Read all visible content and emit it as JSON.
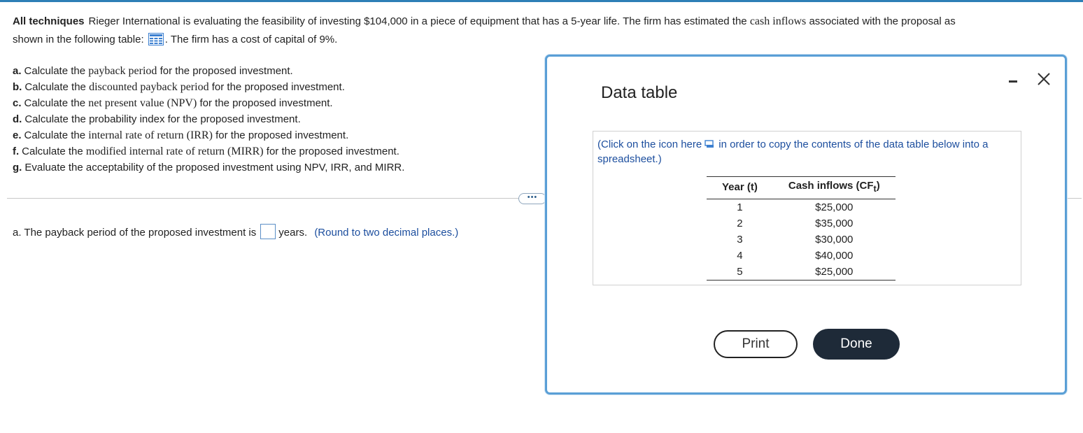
{
  "intro": {
    "label": "All techniques",
    "text_part1": "Rieger International is evaluating the feasibility of investing $104,000 in a piece of equipment that has a 5-year life. The firm has estimated the",
    "cash_inflows": "cash inflows",
    "text_part2": "associated with the proposal as",
    "line2_prefix": "shown in the following table:",
    "line2_suffix": ". The firm has a cost of capital of 9%.",
    "table_icon": "data-table-grid-icon"
  },
  "parts": [
    {
      "letter": "a.",
      "pre": "Calculate the",
      "term": "payback period",
      "post": "for the proposed investment."
    },
    {
      "letter": "b.",
      "pre": "Calculate the",
      "term": "discounted payback period",
      "post": "for the proposed investment."
    },
    {
      "letter": "c.",
      "pre": "Calculate the",
      "term": "net present value (NPV)",
      "post": "for the proposed investment."
    },
    {
      "letter": "d.",
      "pre": "Calculate the probability index for the proposed investment.",
      "term": "",
      "post": ""
    },
    {
      "letter": "e.",
      "pre": "Calculate the",
      "term": "internal rate of return (IRR)",
      "post": "for the proposed investment."
    },
    {
      "letter": "f.",
      "pre": "Calculate the",
      "term": "modified internal rate of return (MIRR)",
      "post": "for the proposed investment."
    },
    {
      "letter": "g.",
      "pre": "Evaluate the acceptability of the proposed investment using NPV, IRR, and MIRR.",
      "term": "",
      "post": ""
    }
  ],
  "more_button": "•••",
  "answer": {
    "prefix": "a. The payback period of the proposed investment is",
    "value": "",
    "unit": "years.",
    "hint": "(Round to two decimal places.)"
  },
  "modal": {
    "title": "Data table",
    "minimize_icon": "minimize-icon",
    "close_icon": "close-icon",
    "copy_note_pre": "(Click on the icon here",
    "copy_note_post": "in order to copy the contents of the data table below into a spreadsheet.)",
    "copy_icon": "copy-icon",
    "table": {
      "headers": [
        "Year (t)",
        "Cash inflows (CF"
      ],
      "header_sub": "t",
      "rows": [
        {
          "year": "1",
          "cf": "$25,000"
        },
        {
          "year": "2",
          "cf": "$35,000"
        },
        {
          "year": "3",
          "cf": "$30,000"
        },
        {
          "year": "4",
          "cf": "$40,000"
        },
        {
          "year": "5",
          "cf": "$25,000"
        }
      ]
    },
    "print_label": "Print",
    "done_label": "Done"
  },
  "colors": {
    "accent": "#5a9fd6",
    "link_blue": "#1c4e9e",
    "done_bg": "#1e2a38"
  }
}
